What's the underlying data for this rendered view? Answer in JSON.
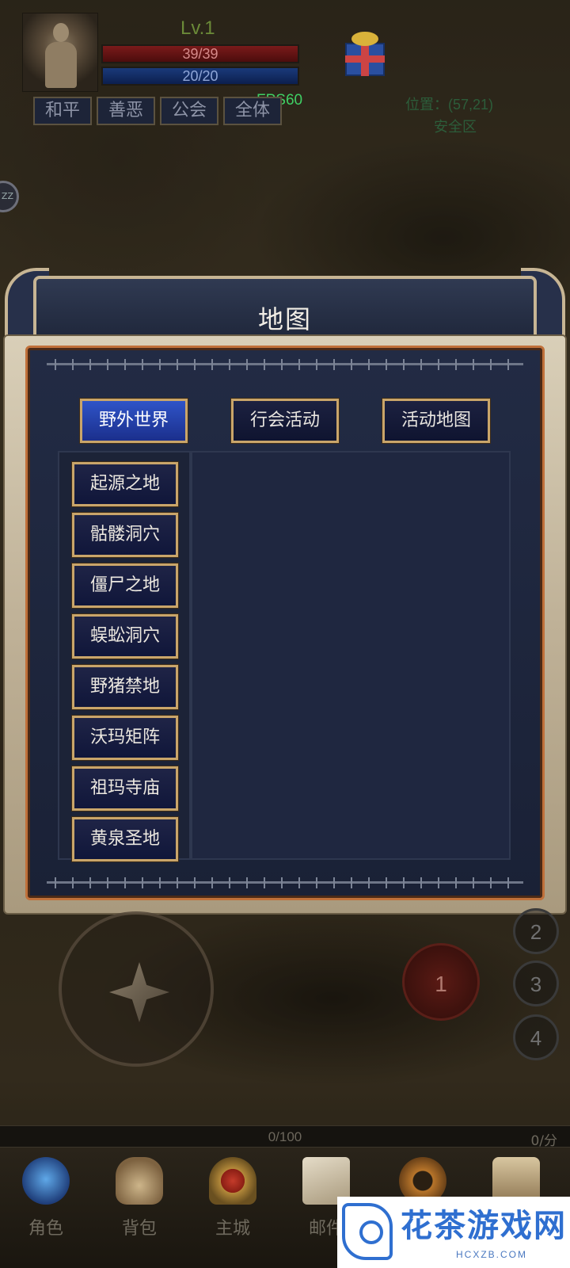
{
  "player": {
    "level": "Lv.1",
    "hp": "39/39",
    "mp": "20/20",
    "fps": "FPS60"
  },
  "pk_modes": [
    "和平",
    "善恶",
    "公会",
    "全体"
  ],
  "map_info": {
    "coords": "位置：(57,21)",
    "zone": "安全区"
  },
  "dialog": {
    "title": "地图",
    "tabs": [
      {
        "label": "野外世界",
        "active": true
      },
      {
        "label": "行会活动",
        "active": false
      },
      {
        "label": "活动地图",
        "active": false
      }
    ],
    "maps": [
      "起源之地",
      "骷髅洞穴",
      "僵尸之地",
      "蜈蚣洞穴",
      "野猪禁地",
      "沃玛矩阵",
      "祖玛寺庙",
      "黄泉圣地"
    ]
  },
  "skills": [
    "1",
    "2",
    "3",
    "4"
  ],
  "exp": {
    "value": "0/100",
    "score": "0/分"
  },
  "bottom_nav": [
    {
      "label": "角色",
      "icon": "character-orb-icon"
    },
    {
      "label": "背包",
      "icon": "bag-icon"
    },
    {
      "label": "主城",
      "icon": "castle-shield-icon"
    },
    {
      "label": "邮件",
      "icon": "mail-scroll-icon"
    },
    {
      "label": "",
      "icon": "gear-icon"
    },
    {
      "label": "",
      "icon": "scroll-icon"
    }
  ],
  "watermark": {
    "text": "花茶游戏网",
    "sub": "HCXZB.COM"
  },
  "colors": {
    "active_tab": "#2f54c8",
    "button_border": "#c9a56a",
    "frame_accent": "#c0703a",
    "fps_green": "#3fcf64"
  }
}
